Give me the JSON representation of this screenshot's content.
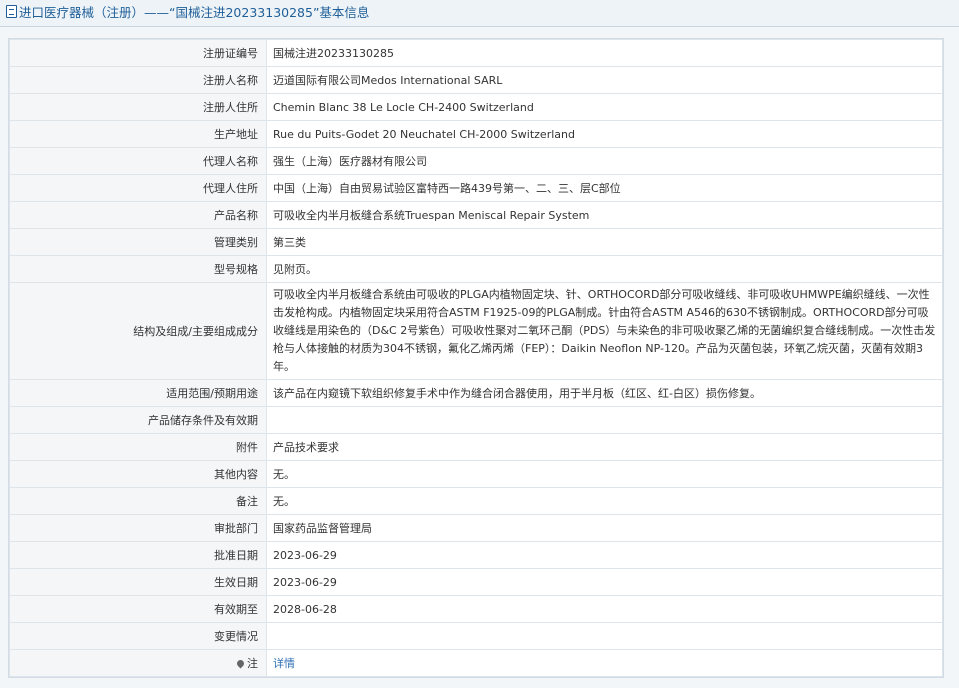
{
  "header": {
    "title": "进口医疗器械（注册）——“国械注进20233130285”基本信息"
  },
  "rows": [
    {
      "label": "注册证编号",
      "value": "国械注进20233130285"
    },
    {
      "label": "注册人名称",
      "value": "迈道国际有限公司Medos International SARL"
    },
    {
      "label": "注册人住所",
      "value": "Chemin Blanc 38 Le Locle CH-2400 Switzerland"
    },
    {
      "label": "生产地址",
      "value": "Rue du Puits-Godet 20 Neuchatel CH-2000 Switzerland"
    },
    {
      "label": "代理人名称",
      "value": "强生（上海）医疗器材有限公司"
    },
    {
      "label": "代理人住所",
      "value": "中国（上海）自由贸易试验区富特西一路439号第一、二、三、层C部位"
    },
    {
      "label": "产品名称",
      "value": "可吸收全内半月板缝合系统Truespan Meniscal Repair System"
    },
    {
      "label": "管理类别",
      "value": "第三类"
    },
    {
      "label": "型号规格",
      "value": "见附页。"
    },
    {
      "label": "结构及组成/主要组成成分",
      "value": "可吸收全内半月板缝合系统由可吸收的PLGA内植物固定块、针、ORTHOCORD部分可吸收缝线、非可吸收UHMWPE编织缝线、一次性击发枪构成。内植物固定块采用符合ASTM F1925-09的PLGA制成。针由符合ASTM A546的630不锈钢制成。ORTHOCORD部分可吸收缝线是用染色的（D&C 2号紫色）可吸收性聚对二氧环己酮（PDS）与未染色的非可吸收聚乙烯的无菌编织复合缝线制成。一次性击发枪与人体接触的材质为304不锈钢，氟化乙烯丙烯（FEP）：Daikin Neoflon NP-120。产品为灭菌包装，环氧乙烷灭菌，灭菌有效期3年。"
    },
    {
      "label": "适用范围/预期用途",
      "value": "该产品在内窥镜下软组织修复手术中作为缝合闭合器使用，用于半月板（红区、红-白区）损伤修复。"
    },
    {
      "label": "产品储存条件及有效期",
      "value": ""
    },
    {
      "label": "附件",
      "value": "产品技术要求"
    },
    {
      "label": "其他内容",
      "value": "无。"
    },
    {
      "label": "备注",
      "value": "无。"
    },
    {
      "label": "审批部门",
      "value": "国家药品监督管理局"
    },
    {
      "label": "批准日期",
      "value": "2023-06-29"
    },
    {
      "label": "生效日期",
      "value": "2023-06-29"
    },
    {
      "label": "有效期至",
      "value": "2028-06-28"
    },
    {
      "label": "变更情况",
      "value": ""
    }
  ],
  "note": {
    "label": "注",
    "link_text": "详情"
  }
}
